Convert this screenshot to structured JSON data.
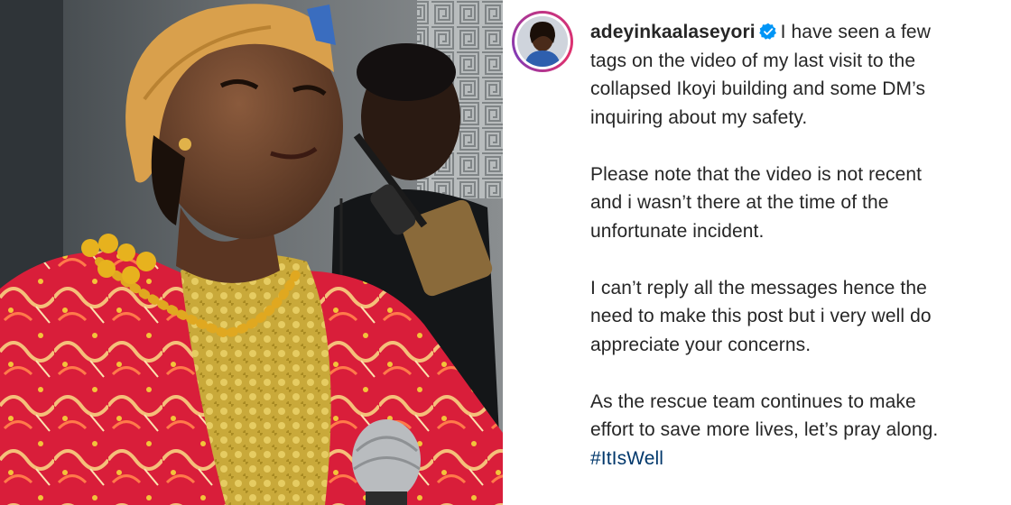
{
  "post": {
    "username": "adeyinkaalaseyori",
    "verified": true,
    "paragraphs": [
      "I have seen a few\ntags on the video of my last visit to the\ncollapsed Ikoyi building and some DM’s\ninquiring about my safety.",
      "Please note that the video is not recent\nand i wasn’t there at the time of the\nunfortunate incident.",
      "I can’t reply all the messages hence the\nneed to make this post but i very well do\nappreciate your concerns.",
      "As the rescue team continues to make\neffort to save more lives, let’s pray along."
    ],
    "hashtag": "#ItIsWell"
  },
  "colors": {
    "text": "#262626",
    "hashtag": "#00376b",
    "verified_badge": "#0095f6",
    "story_ring": "#c13584"
  }
}
